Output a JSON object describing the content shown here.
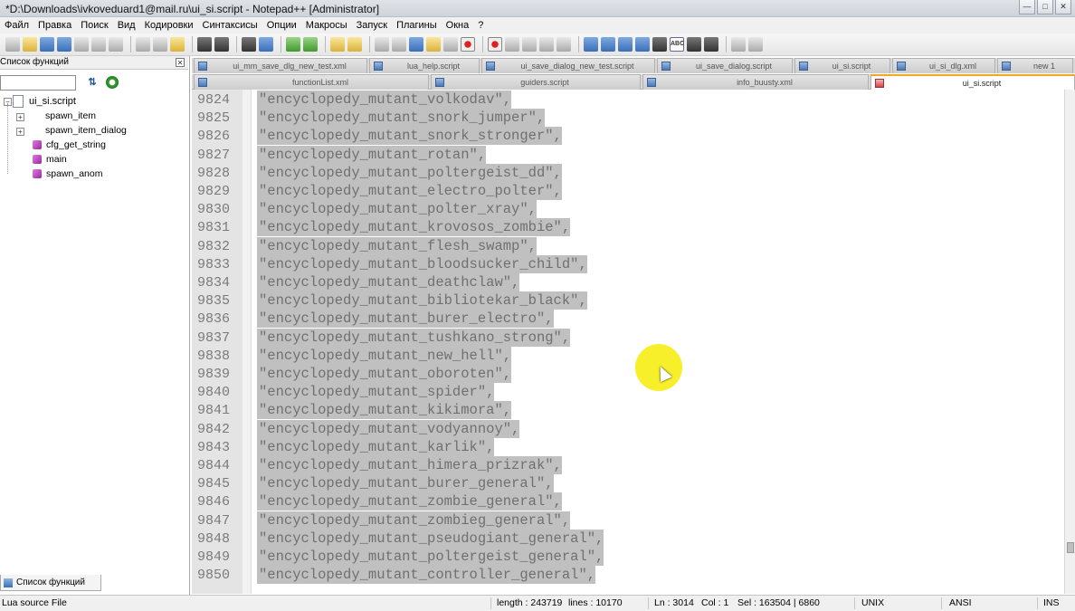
{
  "window": {
    "title": "*D:\\Downloads\\ivkoveduard1@mail.ru\\ui_si.script - Notepad++ [Administrator]",
    "buttons": [
      "—",
      "□",
      "✕"
    ]
  },
  "menu": [
    "Файл",
    "Правка",
    "Поиск",
    "Вид",
    "Кодировки",
    "Синтаксисы",
    "Опции",
    "Макросы",
    "Запуск",
    "Плагины",
    "Окна",
    "?"
  ],
  "function_panel": {
    "header": "Список функций",
    "search_value": "",
    "root": "ui_si.script",
    "items": [
      "spawn_item",
      "spawn_item_dialog",
      "cfg_get_string",
      "main",
      "spawn_anom"
    ],
    "bottom_tab": "Список функций"
  },
  "tabs_row1": [
    "ui_mm_save_dlg_new_test.xml",
    "lua_help.script",
    "ui_save_dialog_new_test.script",
    "ui_save_dialog.script",
    "ui_si.script",
    "ui_si_dlg.xml",
    "new 1"
  ],
  "tabs_row2": [
    "functionList.xml",
    "guiders.script",
    "info_buusty.xml",
    "ui_si.script"
  ],
  "editor": {
    "lines": [
      {
        "n": "9824",
        "text": "\"encyclopedy_mutant_volkodav\","
      },
      {
        "n": "9825",
        "text": "\"encyclopedy_mutant_snork_jumper\","
      },
      {
        "n": "9826",
        "text": "\"encyclopedy_mutant_snork_stronger\","
      },
      {
        "n": "9827",
        "text": "\"encyclopedy_mutant_rotan\","
      },
      {
        "n": "9828",
        "text": "\"encyclopedy_mutant_poltergeist_dd\","
      },
      {
        "n": "9829",
        "text": "\"encyclopedy_mutant_electro_polter\","
      },
      {
        "n": "9830",
        "text": "\"encyclopedy_mutant_polter_xray\","
      },
      {
        "n": "9831",
        "text": "\"encyclopedy_mutant_krovosos_zombie\","
      },
      {
        "n": "9832",
        "text": "\"encyclopedy_mutant_flesh_swamp\","
      },
      {
        "n": "9833",
        "text": "\"encyclopedy_mutant_bloodsucker_child\","
      },
      {
        "n": "9834",
        "text": "\"encyclopedy_mutant_deathclaw\","
      },
      {
        "n": "9835",
        "text": "\"encyclopedy_mutant_bibliotekar_black\","
      },
      {
        "n": "9836",
        "text": "\"encyclopedy_mutant_burer_electro\","
      },
      {
        "n": "9837",
        "text": "\"encyclopedy_mutant_tushkano_strong\","
      },
      {
        "n": "9838",
        "text": "\"encyclopedy_mutant_new_hell\","
      },
      {
        "n": "9839",
        "text": "\"encyclopedy_mutant_oboroten\","
      },
      {
        "n": "9840",
        "text": "\"encyclopedy_mutant_spider\","
      },
      {
        "n": "9841",
        "text": "\"encyclopedy_mutant_kikimora\","
      },
      {
        "n": "9842",
        "text": "\"encyclopedy_mutant_vodyannoy\","
      },
      {
        "n": "9843",
        "text": "\"encyclopedy_mutant_karlik\","
      },
      {
        "n": "9844",
        "text": "\"encyclopedy_mutant_himera_prizrak\","
      },
      {
        "n": "9845",
        "text": "\"encyclopedy_mutant_burer_general\","
      },
      {
        "n": "9846",
        "text": "\"encyclopedy_mutant_zombie_general\","
      },
      {
        "n": "9847",
        "text": "\"encyclopedy_mutant_zombieg_general\","
      },
      {
        "n": "9848",
        "text": "\"encyclopedy_mutant_pseudogiant_general\","
      },
      {
        "n": "9849",
        "text": "\"encyclopedy_mutant_poltergeist_general\","
      },
      {
        "n": "9850",
        "text": "\"encyclopedy_mutant_controller_general\","
      }
    ]
  },
  "status": {
    "type": "Lua source File",
    "length": "length : 243719",
    "lines": "lines : 10170",
    "ln": "Ln : 3014",
    "col": "Col : 1",
    "sel": "Sel : 163504 | 6860",
    "eol": "UNIX",
    "encoding": "ANSI",
    "mode": "INS"
  },
  "colors": {
    "selection": "#c0c0c0",
    "gutter": "#e4e4e4",
    "active_tab_accent": "#f5a623",
    "cursor_highlight": "#f8ee20"
  }
}
